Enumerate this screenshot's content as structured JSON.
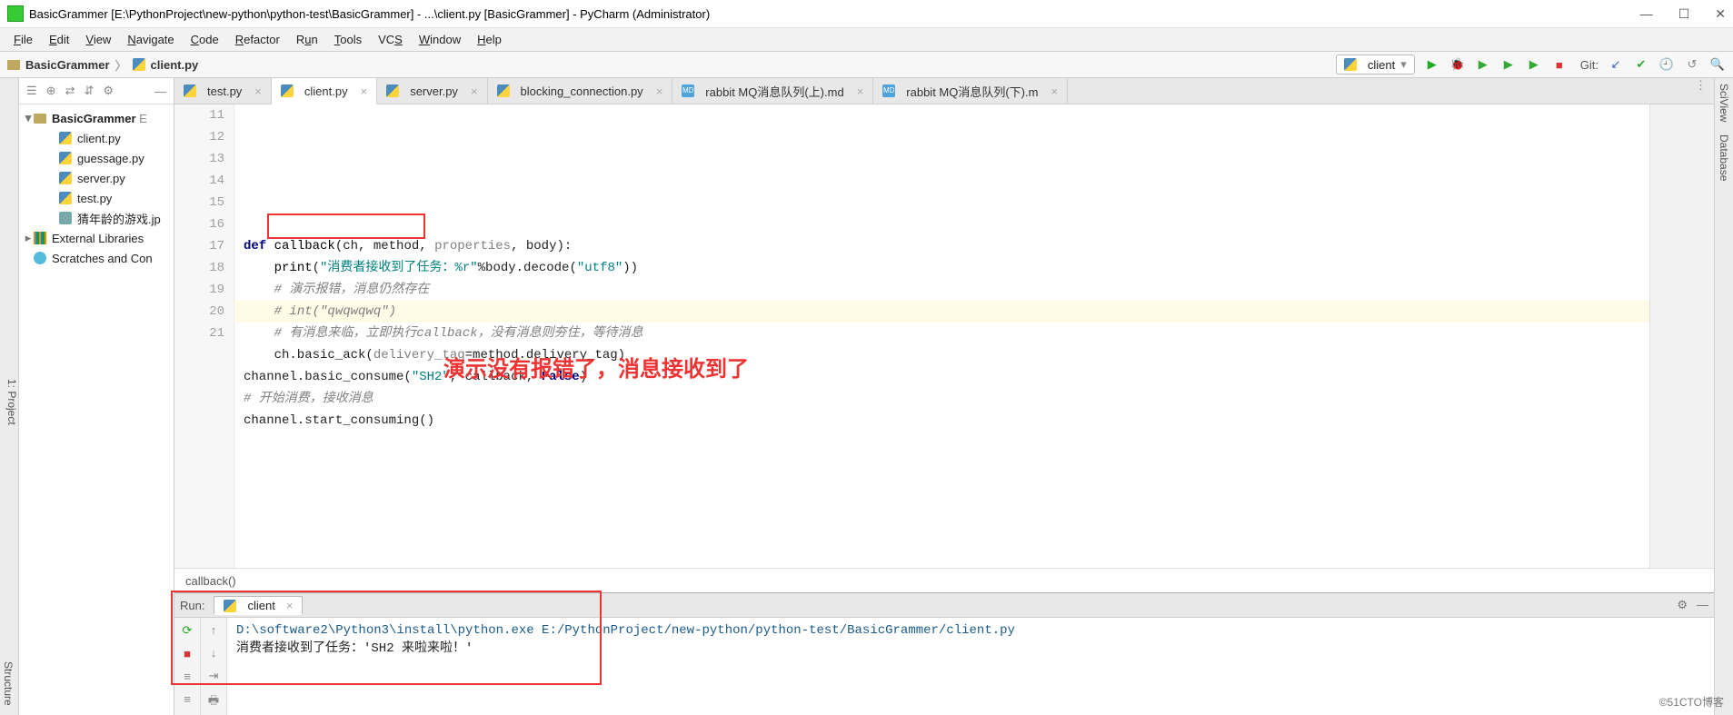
{
  "window": {
    "title": "BasicGrammer [E:\\PythonProject\\new-python\\python-test\\BasicGrammer] - ...\\client.py [BasicGrammer] - PyCharm (Administrator)"
  },
  "menubar": [
    "File",
    "Edit",
    "View",
    "Navigate",
    "Code",
    "Refactor",
    "Run",
    "Tools",
    "VCS",
    "Window",
    "Help"
  ],
  "breadcrumbs": {
    "root": "BasicGrammer",
    "file": "client.py"
  },
  "run_config": {
    "selected": "client",
    "git_label": "Git:"
  },
  "project_tree": {
    "root": {
      "name": "BasicGrammer",
      "suffix": "E"
    },
    "files": [
      "client.py",
      "guessage.py",
      "server.py",
      "test.py",
      "猜年龄的游戏.jp"
    ],
    "libs": "External Libraries",
    "scratch": "Scratches and Con"
  },
  "tabs": [
    {
      "kind": "py",
      "label": "test.py",
      "active": false
    },
    {
      "kind": "py",
      "label": "client.py",
      "active": true
    },
    {
      "kind": "py",
      "label": "server.py",
      "active": false
    },
    {
      "kind": "py",
      "label": "blocking_connection.py",
      "active": false
    },
    {
      "kind": "md",
      "label": "rabbit MQ消息队列(上).md",
      "active": false
    },
    {
      "kind": "md",
      "label": "rabbit MQ消息队列(下).m",
      "active": false
    }
  ],
  "code": {
    "first_line_no": 11,
    "lines": [
      {
        "n": 11,
        "html": ""
      },
      {
        "n": 12,
        "html": ""
      },
      {
        "n": 13,
        "html": "<span class='kw'>def</span> <span class='fn'>callback</span>(ch, method, <span class='param'>properties</span>, body):"
      },
      {
        "n": 14,
        "html": "    <span class='fn'>print</span>(<span class='str'>\"消费者接收到了任务：%r\"</span>%body.decode(<span class='str'>\"utf8\"</span>))"
      },
      {
        "n": 15,
        "html": "    <span class='cm'># 演示报错，消息仍然存在</span>"
      },
      {
        "n": 16,
        "html": "    <span class='cm'># int(\"qwqwqwq\")</span>",
        "hl": true
      },
      {
        "n": 17,
        "html": "    <span class='cm'># 有消息来临，立即执行callback，没有消息则夯住，等待消息</span>"
      },
      {
        "n": 18,
        "html": "    ch.basic_ack(<span class='param'>delivery_tag</span>=method.delivery_tag)"
      },
      {
        "n": 19,
        "html": "channel.basic_consume(<span class='str'>\"SH2\"</span>, callback, <span class='kw'>False</span>)"
      },
      {
        "n": 20,
        "html": "<span class='cm'># 开始消费，接收消息</span>"
      },
      {
        "n": 21,
        "html": "channel.start_consuming()"
      }
    ],
    "breadcrumb_fn": "callback()"
  },
  "annotation": "演示没有报错了，消息接收到了",
  "run_panel": {
    "label": "Run:",
    "tab": "client",
    "lines": [
      "D:\\software2\\Python3\\install\\python.exe E:/PythonProject/new-python/python-test/BasicGrammer/client.py",
      "消费者接收到了任务：'SH2 来啦来啦！'"
    ]
  },
  "sideL": "1: Project",
  "sideR": [
    "SciView",
    "Database"
  ],
  "bottom_left": "Structure",
  "watermark": "©51CTO博客"
}
